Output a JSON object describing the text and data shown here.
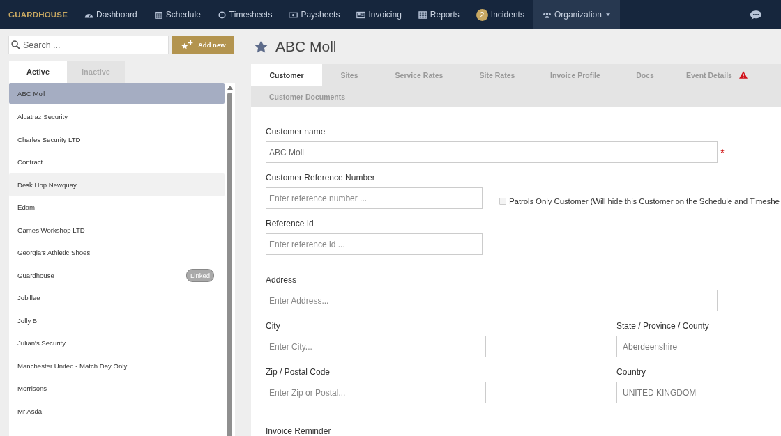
{
  "navbar": {
    "brand": "GUARDHOUSE",
    "items": [
      {
        "label": "Dashboard",
        "selected": false
      },
      {
        "label": "Schedule",
        "selected": false
      },
      {
        "label": "Timesheets",
        "selected": false
      },
      {
        "label": "Paysheets",
        "selected": false
      },
      {
        "label": "Invoicing",
        "selected": false
      },
      {
        "label": "Reports",
        "selected": false
      },
      {
        "label": "Incidents",
        "badge": "2",
        "selected": false
      },
      {
        "label": "Organization",
        "dropdown": true,
        "selected": true
      }
    ]
  },
  "sidebar": {
    "search": {
      "placeholder": "Search ..."
    },
    "add_button": "Add new",
    "tabs": [
      {
        "label": "Active",
        "selected": true
      },
      {
        "label": "Inactive",
        "selected": false
      }
    ],
    "items": [
      {
        "name": "ABC Moll",
        "selected": true,
        "hovered": false
      },
      {
        "name": "Alcatraz Security",
        "selected": false,
        "hovered": false
      },
      {
        "name": "Charles Security LTD",
        "selected": false,
        "hovered": false
      },
      {
        "name": "Contract",
        "selected": false,
        "hovered": false
      },
      {
        "name": "Desk Hop Newquay",
        "selected": false,
        "hovered": true
      },
      {
        "name": "Edam",
        "selected": false,
        "hovered": false
      },
      {
        "name": "Games Workshop LTD",
        "selected": false,
        "hovered": false
      },
      {
        "name": "Georgia's Athletic Shoes",
        "selected": false,
        "hovered": false
      },
      {
        "name": "Guardhouse",
        "badge": "Linked",
        "selected": false,
        "hovered": false
      },
      {
        "name": "Jobillee",
        "selected": false,
        "hovered": false
      },
      {
        "name": "Jolly B",
        "selected": false,
        "hovered": false
      },
      {
        "name": "Julian's Security",
        "selected": false,
        "hovered": false
      },
      {
        "name": "Manchester United - Match Day Only",
        "selected": false,
        "hovered": false
      },
      {
        "name": "Morrisons",
        "selected": false,
        "hovered": false
      },
      {
        "name": "Mr Asda",
        "selected": false,
        "hovered": false
      }
    ]
  },
  "title": "ABC Moll",
  "tabs": [
    {
      "label": "Customer",
      "selected": true
    },
    {
      "label": "Sites",
      "selected": false
    },
    {
      "label": "Service Rates",
      "selected": false
    },
    {
      "label": "Site Rates",
      "selected": false
    },
    {
      "label": "Invoice Profile",
      "selected": false
    },
    {
      "label": "Docs",
      "selected": false
    },
    {
      "label": "Event Details",
      "warning": true,
      "selected": false
    },
    {
      "label": "Customer Documents",
      "selected": false
    }
  ],
  "form": {
    "customer_name": {
      "label": "Customer name",
      "value": "ABC Moll",
      "required": true,
      "required_mark": "*"
    },
    "reference_number": {
      "label": "Customer Reference Number",
      "placeholder": "Enter reference number ..."
    },
    "patrols_only": {
      "label": "Patrols Only Customer (Will hide this Customer on the Schedule and Timeshe",
      "checked": false
    },
    "reference_id": {
      "label": "Reference Id",
      "placeholder": "Enter reference id ..."
    },
    "address": {
      "label": "Address",
      "placeholder": "Enter Address..."
    },
    "city": {
      "label": "City",
      "placeholder": "Enter City..."
    },
    "state": {
      "label": "State / Province / County",
      "value": "Aberdeenshire"
    },
    "zip": {
      "label": "Zip / Postal Code",
      "placeholder": "Enter Zip or Postal..."
    },
    "country": {
      "label": "Country",
      "value": "UNITED KINGDOM"
    },
    "invoice_reminder": {
      "label": "Invoice Reminder"
    }
  }
}
